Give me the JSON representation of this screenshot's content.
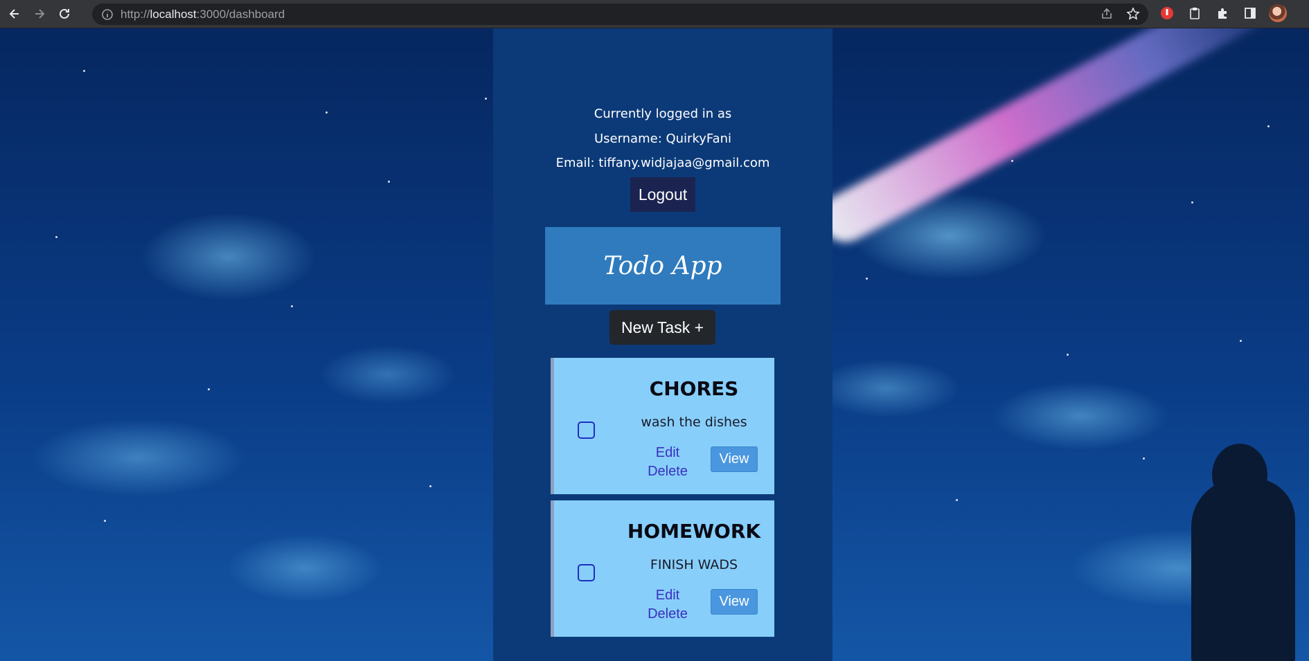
{
  "browser": {
    "url_prefix": "http://",
    "url_host": "localhost",
    "url_rest": ":3000/dashboard"
  },
  "user": {
    "status_line": "Currently logged in as",
    "username_line": "Username: QuirkyFani",
    "email_line": "Email: tiffany.widjajaa@gmail.com",
    "logout_label": "Logout"
  },
  "app": {
    "title": "Todo App",
    "new_task_label": "New Task +"
  },
  "tasks": [
    {
      "title": "CHORES",
      "description": "wash the dishes",
      "edit_label": "Edit",
      "delete_label": "Delete",
      "view_label": "View",
      "completed": false
    },
    {
      "title": "HOMEWORK",
      "description": "FINISH WADS",
      "edit_label": "Edit",
      "delete_label": "Delete",
      "view_label": "View",
      "completed": false
    }
  ],
  "colors": {
    "panel": "#0c3a78",
    "header": "#2f7bbd",
    "card": "#87cffa",
    "view_button": "#4a97df",
    "link": "#3a2fbf"
  }
}
